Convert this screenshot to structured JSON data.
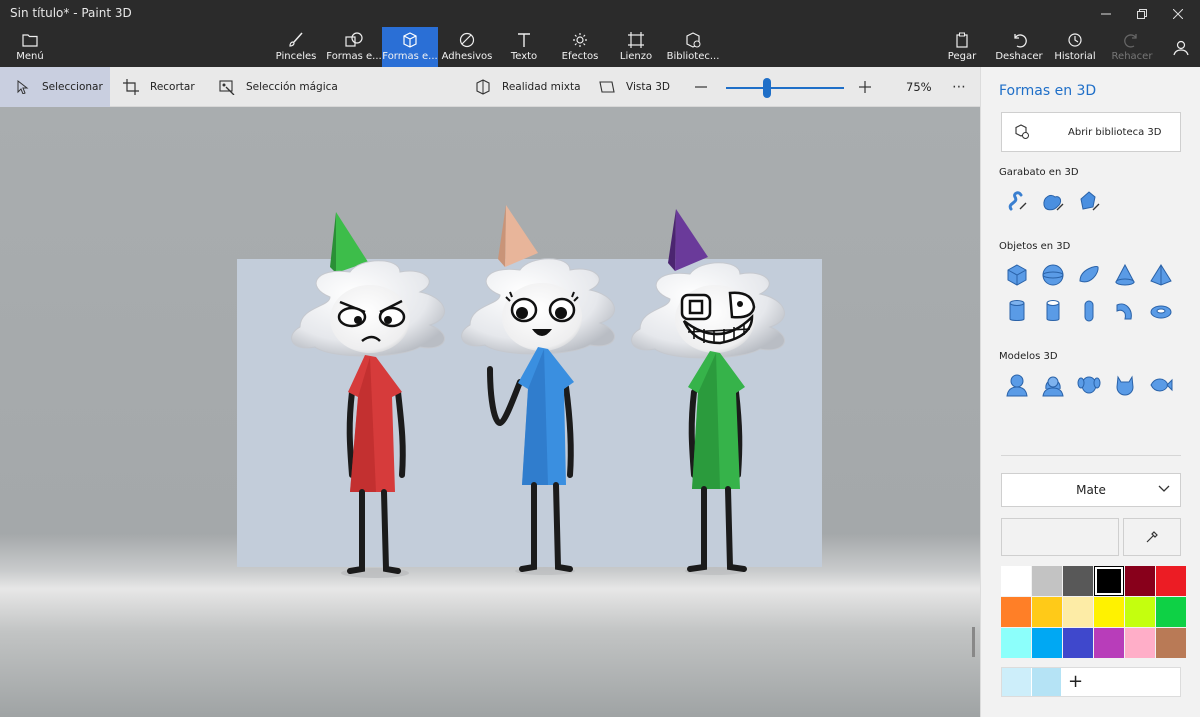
{
  "window": {
    "title": "Sin título* - Paint 3D"
  },
  "menu": {
    "label": "Menú"
  },
  "toolbar": {
    "items": [
      {
        "label": "Pinceles",
        "icon": "brush-icon"
      },
      {
        "label": "Formas e...",
        "icon": "2d-shapes-icon"
      },
      {
        "label": "Formas e...",
        "icon": "3d-shapes-icon"
      },
      {
        "label": "Adhesivos",
        "icon": "stickers-icon"
      },
      {
        "label": "Texto",
        "icon": "text-icon"
      },
      {
        "label": "Efectos",
        "icon": "effects-icon"
      },
      {
        "label": "Lienzo",
        "icon": "canvas-icon"
      },
      {
        "label": "Bibliotec...",
        "icon": "library-icon"
      }
    ],
    "right": [
      {
        "label": "Pegar",
        "icon": "paste-icon"
      },
      {
        "label": "Deshacer",
        "icon": "undo-icon"
      },
      {
        "label": "Historial",
        "icon": "history-icon"
      },
      {
        "label": "Rehacer",
        "icon": "redo-icon"
      }
    ]
  },
  "subbar": {
    "select": "Seleccionar",
    "crop": "Recortar",
    "magic_select": "Selección mágica",
    "mixed_reality": "Realidad mixta",
    "view_3d": "Vista 3D",
    "zoom": "75%",
    "zoom_level": 0.35
  },
  "panel": {
    "title": "Formas en 3D",
    "open_library": "Abrir biblioteca 3D",
    "doodle_title": "Garabato en 3D",
    "objects_title": "Objetos en 3D",
    "models_title": "Modelos 3D",
    "material": "Mate",
    "palette": [
      "#ffffff",
      "#c3c3c3",
      "#585858",
      "#000000",
      "#88001b",
      "#ec1c24",
      "#ff7f27",
      "#ffca18",
      "#fdeca6",
      "#fff200",
      "#c4ff0e",
      "#0ed145",
      "#8cfffb",
      "#00a8f3",
      "#3f48cc",
      "#b83dba",
      "#ffaec8",
      "#b97a56"
    ]
  },
  "scene": {
    "characters": [
      {
        "hat": "#3dbd4a",
        "dress": "#d63b3b"
      },
      {
        "hat": "#e8b59a",
        "dress": "#3a8fe0"
      },
      {
        "hat": "#6a3a9a",
        "dress": "#36b34a"
      }
    ]
  }
}
